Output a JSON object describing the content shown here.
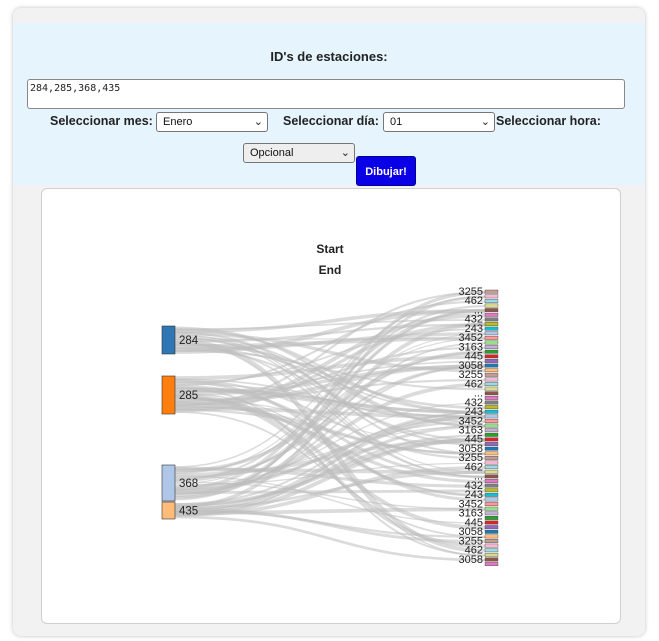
{
  "form": {
    "title": "ID's de estaciones:",
    "ids_value": "284,285,368,435",
    "month_label": "Seleccionar mes:",
    "month_value": "Enero",
    "day_label": "Seleccionar día:",
    "day_value": "01",
    "hour_label": "Seleccionar hora:",
    "hour_value": "Opcional",
    "draw_button": "Dibujar!"
  },
  "icons": {
    "select_arrow": "chevron-down-icon"
  },
  "chart_data": {
    "type": "sankey",
    "title_start": "Start",
    "title_end": "End",
    "sources": [
      {
        "id": "284",
        "color": "#2f77b4"
      },
      {
        "id": "285",
        "color": "#ff7f0e"
      },
      {
        "id": "368",
        "color": "#aec7e8"
      },
      {
        "id": "435",
        "color": "#ffbb78"
      }
    ],
    "targets_labels": [
      "3255",
      "462",
      "...",
      "432",
      "243",
      "3452",
      "3163",
      "445",
      "3058"
    ],
    "top_target": "3255",
    "bottom_target": "3058"
  }
}
